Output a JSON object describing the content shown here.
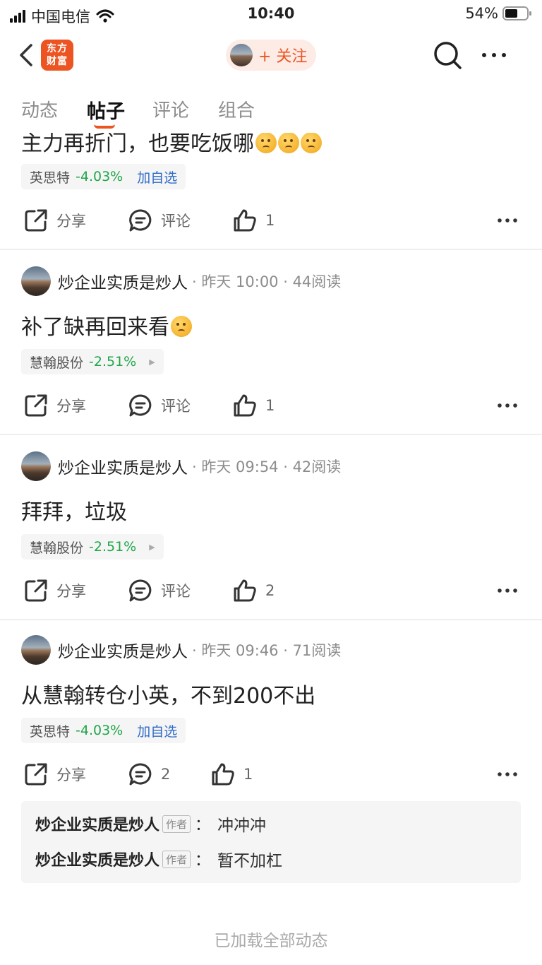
{
  "status_bar": {
    "carrier": "中国电信",
    "time": "10:40",
    "battery": "54%"
  },
  "nav": {
    "logo_line1": "东方",
    "logo_line2": "财富",
    "follow_label": "+ 关注"
  },
  "tabs": [
    {
      "label": "动态",
      "active": false
    },
    {
      "label": "帖子",
      "active": true
    },
    {
      "label": "评论",
      "active": false
    },
    {
      "label": "组合",
      "active": false
    }
  ],
  "posts": [
    {
      "text_partial": "主力再折门，也要吃饭哪",
      "stock": {
        "name": "英思特",
        "change": "-4.03%",
        "add_label": "加自选"
      },
      "actions": {
        "share": "分享",
        "comment": "评论",
        "likes": "1"
      }
    },
    {
      "author": "炒企业实质是炒人",
      "meta": "· 昨天 10:00 · 44阅读",
      "text": "补了缺再回来看",
      "stock": {
        "name": "慧翰股份",
        "change": "-2.51%"
      },
      "actions": {
        "share": "分享",
        "comment": "评论",
        "likes": "1"
      }
    },
    {
      "author": "炒企业实质是炒人",
      "meta": "· 昨天 09:54 · 42阅读",
      "text": "拜拜，垃圾",
      "stock": {
        "name": "慧翰股份",
        "change": "-2.51%"
      },
      "actions": {
        "share": "分享",
        "comment": "评论",
        "likes": "2"
      }
    },
    {
      "author": "炒企业实质是炒人",
      "meta": "· 昨天 09:46 · 71阅读",
      "text": "从慧翰转仓小英，不到200不出",
      "stock": {
        "name": "英思特",
        "change": "-4.03%",
        "add_label": "加自选"
      },
      "actions": {
        "share": "分享",
        "comment": "2",
        "likes": "1"
      },
      "replies": [
        {
          "name": "炒企业实质是炒人",
          "tag": "作者",
          "text": "冲冲冲"
        },
        {
          "name": "炒企业实质是炒人",
          "tag": "作者",
          "text": "暂不加杠"
        }
      ]
    }
  ],
  "footer": "已加载全部动态",
  "colors": {
    "brand": "#ec5422",
    "down": "#1fa64a",
    "link": "#2f6cc8"
  }
}
